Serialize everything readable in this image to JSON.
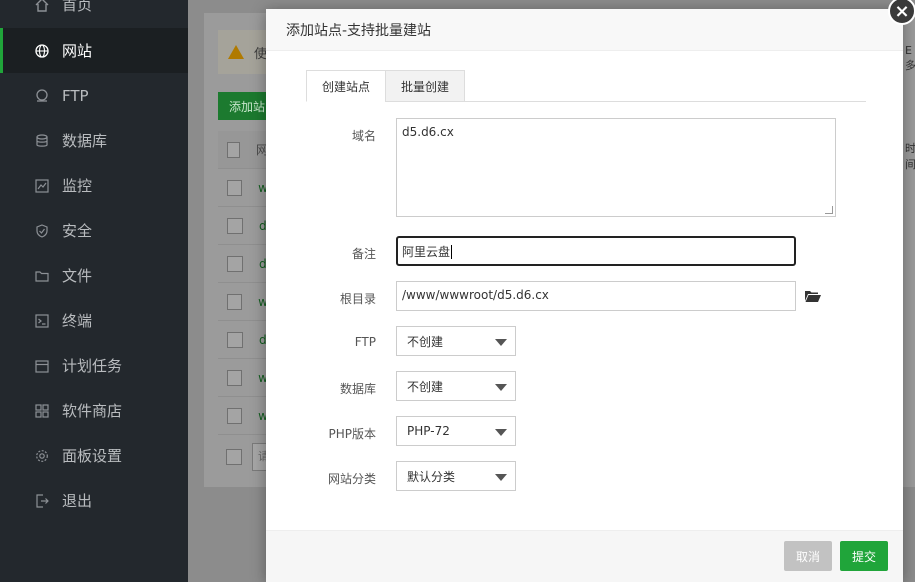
{
  "sidebar": {
    "items": [
      {
        "label": "首页",
        "icon": "home-icon"
      },
      {
        "label": "网站",
        "icon": "globe-icon"
      },
      {
        "label": "FTP",
        "icon": "ftp-icon"
      },
      {
        "label": "数据库",
        "icon": "database-icon"
      },
      {
        "label": "监控",
        "icon": "monitor-icon"
      },
      {
        "label": "安全",
        "icon": "shield-icon"
      },
      {
        "label": "文件",
        "icon": "folder-icon"
      },
      {
        "label": "终端",
        "icon": "terminal-icon"
      },
      {
        "label": "计划任务",
        "icon": "calendar-icon"
      },
      {
        "label": "软件商店",
        "icon": "apps-icon"
      },
      {
        "label": "面板设置",
        "icon": "gear-icon"
      },
      {
        "label": "退出",
        "icon": "logout-icon"
      }
    ],
    "active_index": 1
  },
  "background": {
    "warning_text": "使",
    "add_button": "添加站",
    "table_head": "网",
    "rows": [
      "w",
      "d",
      "d",
      "w",
      "d",
      "w",
      "w"
    ],
    "footer_input": "请",
    "right_peek_top": "E多",
    "right_peek_mid": "时间"
  },
  "modal": {
    "title": "添加站点-支持批量建站",
    "close_symbol": "×",
    "tabs": [
      "创建站点",
      "批量创建"
    ],
    "active_tab": 0,
    "form": {
      "domain_label": "域名",
      "domain_value": "d5.d6.cx",
      "note_label": "备注",
      "note_value": "阿里云盘",
      "root_label": "根目录",
      "root_value": "/www/wwwroot/d5.d6.cx",
      "ftp_label": "FTP",
      "ftp_value": "不创建",
      "db_label": "数据库",
      "db_value": "不创建",
      "php_label": "PHP版本",
      "php_value": "PHP-72",
      "category_label": "网站分类",
      "category_value": "默认分类"
    },
    "buttons": {
      "cancel": "取消",
      "submit": "提交"
    }
  },
  "colors": {
    "accent": "#20a53a",
    "sidebar_bg": "#23282d",
    "cancel_bg": "#c2c2c2"
  }
}
